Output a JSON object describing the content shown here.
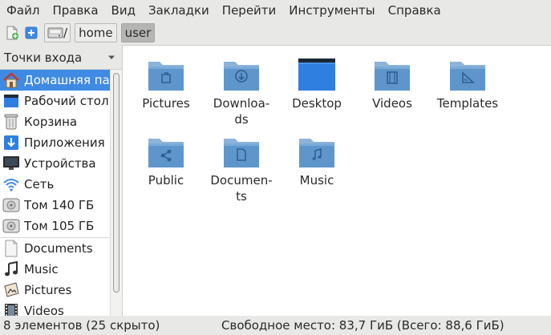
{
  "menu": [
    "Файл",
    "Правка",
    "Вид",
    "Закладки",
    "Перейти",
    "Инструменты",
    "Справка"
  ],
  "toolbar": {
    "new_window_icon": "new-window-icon",
    "new_tab_icon": "new-tab-icon",
    "path": [
      {
        "label": "/",
        "icon": "drive-icon"
      },
      {
        "label": "home"
      },
      {
        "label": "user"
      }
    ]
  },
  "sidebar": {
    "header": "Точки входа",
    "items": [
      {
        "label": "Домашняя папка",
        "icon": "home-icon",
        "selected": true
      },
      {
        "label": "Рабочий стол",
        "icon": "desktop-icon"
      },
      {
        "label": "Корзина",
        "icon": "trash-icon"
      },
      {
        "label": "Приложения",
        "icon": "applications-icon"
      },
      {
        "label": "Устройства",
        "icon": "computer-icon"
      },
      {
        "label": "Сеть",
        "icon": "network-icon"
      },
      {
        "label": "Том 140 ГБ",
        "icon": "disk-icon"
      },
      {
        "label": "Том 105 ГБ",
        "icon": "disk-icon"
      },
      {
        "label": "Documents",
        "icon": "document-icon"
      },
      {
        "label": "Music",
        "icon": "music-icon"
      },
      {
        "label": "Pictures",
        "icon": "pictures-icon"
      },
      {
        "label": "Videos",
        "icon": "videos-icon"
      }
    ]
  },
  "files": [
    {
      "label": "Pictures",
      "icon": "folder-pictures-icon"
    },
    {
      "label": "Downloa-\nds",
      "icon": "folder-download-icon"
    },
    {
      "label": "Desktop",
      "icon": "folder-desktop-icon"
    },
    {
      "label": "Videos",
      "icon": "folder-videos-icon"
    },
    {
      "label": "Templates",
      "icon": "folder-templates-icon"
    },
    {
      "label": "Public",
      "icon": "folder-public-icon"
    },
    {
      "label": "Documen-\nts",
      "icon": "folder-documents-icon"
    },
    {
      "label": "Music",
      "icon": "folder-music-icon"
    }
  ],
  "status": {
    "items": "8 элементов (25 скрыто)",
    "free_space": "Свободное место: 83,7 ГиБ (Всего: 88,6 ГиБ)"
  },
  "colors": {
    "accent": "#3f8ae2",
    "folder": "#6a9fd0"
  }
}
